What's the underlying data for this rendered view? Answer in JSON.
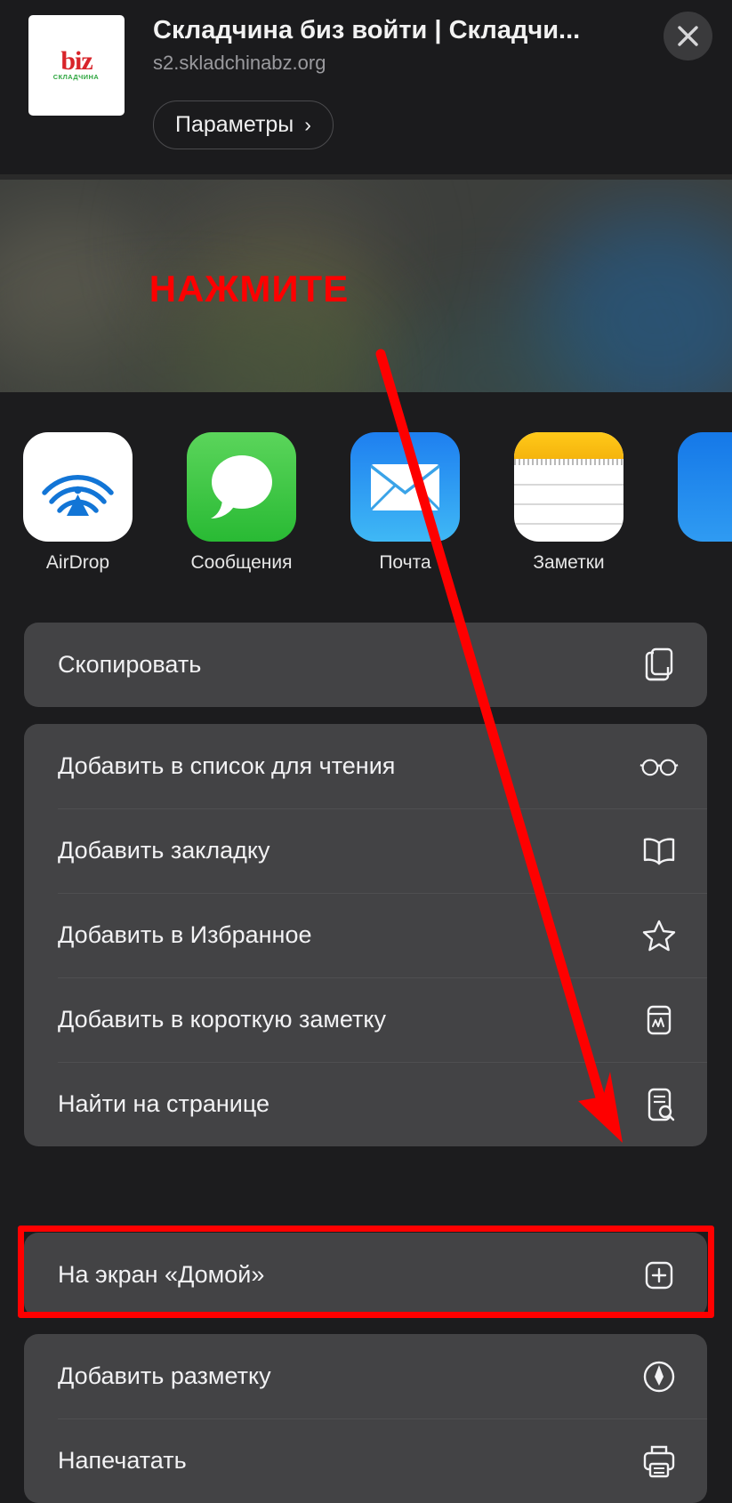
{
  "header": {
    "title": "Складчина биз войти | Складчи...",
    "url": "s2.skladchinabz.org",
    "params_label": "Параметры",
    "params_chevron": "›",
    "close_icon": "close-icon",
    "thumb_logo": "biz",
    "thumb_logo_sub": "СКЛАДЧИНА"
  },
  "preview": {
    "annotation": "НАЖМИТЕ",
    "annotation_color": "#fe0000"
  },
  "apps": [
    {
      "name": "AirDrop",
      "icon": "airdrop-icon"
    },
    {
      "name": "Сообщения",
      "icon": "messages-icon"
    },
    {
      "name": "Почта",
      "icon": "mail-icon"
    },
    {
      "name": "Заметки",
      "icon": "notes-icon"
    },
    {
      "name": "",
      "icon": "app-icon-partial"
    }
  ],
  "groups": [
    {
      "rows": [
        {
          "label": "Скопировать",
          "icon": "copy-icon",
          "highlighted": false
        }
      ]
    },
    {
      "rows": [
        {
          "label": "Добавить в список для чтения",
          "icon": "glasses-icon",
          "highlighted": false
        },
        {
          "label": "Добавить закладку",
          "icon": "book-icon",
          "highlighted": false
        },
        {
          "label": "Добавить в Избранное",
          "icon": "star-icon",
          "highlighted": false
        },
        {
          "label": "Добавить в короткую заметку",
          "icon": "quick-note-icon",
          "highlighted": false
        },
        {
          "label": "Найти на странице",
          "icon": "find-in-page-icon",
          "highlighted": false
        }
      ]
    },
    {
      "rows": [
        {
          "label": "На экран «Домой»",
          "icon": "add-to-home-screen-icon",
          "highlighted": true
        }
      ]
    },
    {
      "rows": [
        {
          "label": "Добавить разметку",
          "icon": "markup-pen-icon",
          "highlighted": false
        },
        {
          "label": "Напечатать",
          "icon": "printer-icon",
          "highlighted": false
        }
      ]
    }
  ],
  "overlay": {
    "highlight_color": "#ff0000",
    "arrow_color": "#fe0000"
  }
}
